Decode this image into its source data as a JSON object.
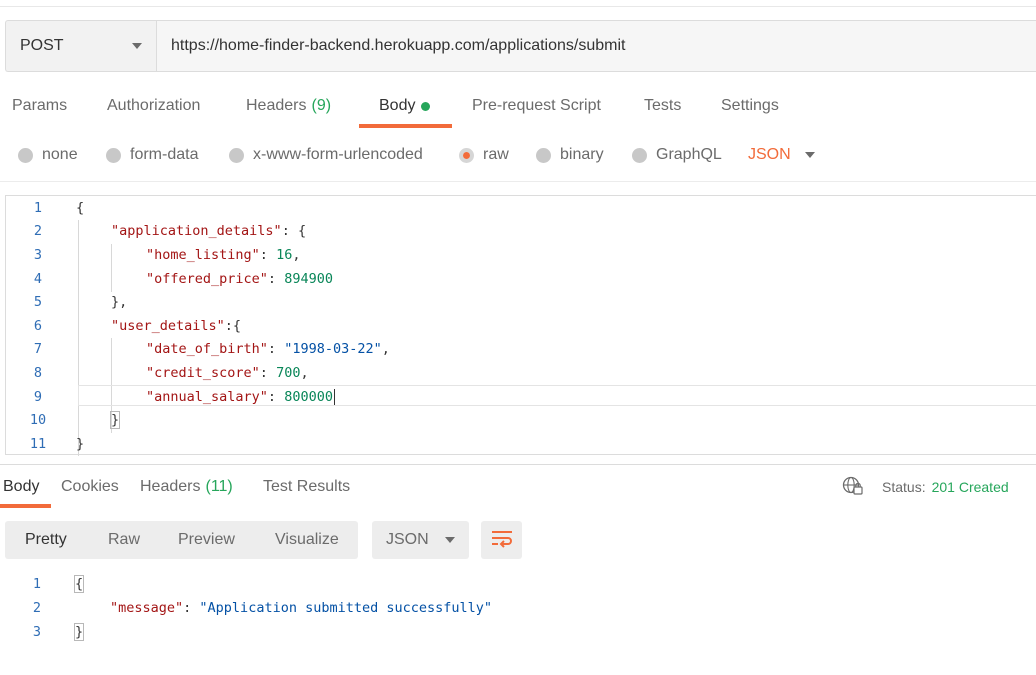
{
  "request": {
    "method": "POST",
    "url": "https://home-finder-backend.herokuapp.com/applications/submit"
  },
  "request_tabs": [
    {
      "label": "Params"
    },
    {
      "label": "Authorization"
    },
    {
      "label": "Headers",
      "count": "(9)"
    },
    {
      "label": "Body",
      "active": true
    },
    {
      "label": "Pre-request Script"
    },
    {
      "label": "Tests"
    },
    {
      "label": "Settings"
    }
  ],
  "body_types": [
    {
      "label": "none"
    },
    {
      "label": "form-data"
    },
    {
      "label": "x-www-form-urlencoded"
    },
    {
      "label": "raw",
      "selected": true
    },
    {
      "label": "binary"
    },
    {
      "label": "GraphQL"
    }
  ],
  "body_format": "JSON",
  "request_body": {
    "line_numbers": [
      "1",
      "2",
      "3",
      "4",
      "5",
      "6",
      "7",
      "8",
      "9",
      "10",
      "11"
    ],
    "l1": "{",
    "l2_key": "\"application_details\"",
    "l2_rest": ": {",
    "l3_key": "\"home_listing\"",
    "l3_sep": ": ",
    "l3_val": "16",
    "l3_end": ",",
    "l4_key": "\"offered_price\"",
    "l4_sep": ": ",
    "l4_val": "894900",
    "l5": "},",
    "l6_key": "\"user_details\"",
    "l6_rest": ":{",
    "l7_key": "\"date_of_birth\"",
    "l7_sep": ": ",
    "l7_val": "\"1998-03-22\"",
    "l7_end": ",",
    "l8_key": "\"credit_score\"",
    "l8_sep": ": ",
    "l8_val": "700",
    "l8_end": ",",
    "l9_key": "\"annual_salary\"",
    "l9_sep": ": ",
    "l9_val": "800000",
    "l10": "}",
    "l11": "}"
  },
  "response_tabs": [
    {
      "label": "Body",
      "active": true
    },
    {
      "label": "Cookies"
    },
    {
      "label": "Headers",
      "count": "(11)"
    },
    {
      "label": "Test Results"
    }
  ],
  "status": {
    "label": "Status:",
    "value": "201 Created"
  },
  "view_modes": [
    {
      "label": "Pretty",
      "active": true
    },
    {
      "label": "Raw"
    },
    {
      "label": "Preview"
    },
    {
      "label": "Visualize"
    }
  ],
  "response_format": "JSON",
  "response_body": {
    "line_numbers": [
      "1",
      "2",
      "3"
    ],
    "l1": "{",
    "l2_key": "\"message\"",
    "l2_sep": ": ",
    "l2_val": "\"Application submitted successfully\"",
    "l3": "}"
  },
  "colors": {
    "accent": "#f26b3a",
    "success": "#26a65b"
  },
  "icons": [
    "chevron-down-icon",
    "globe-icon",
    "wrap-lines-icon"
  ]
}
